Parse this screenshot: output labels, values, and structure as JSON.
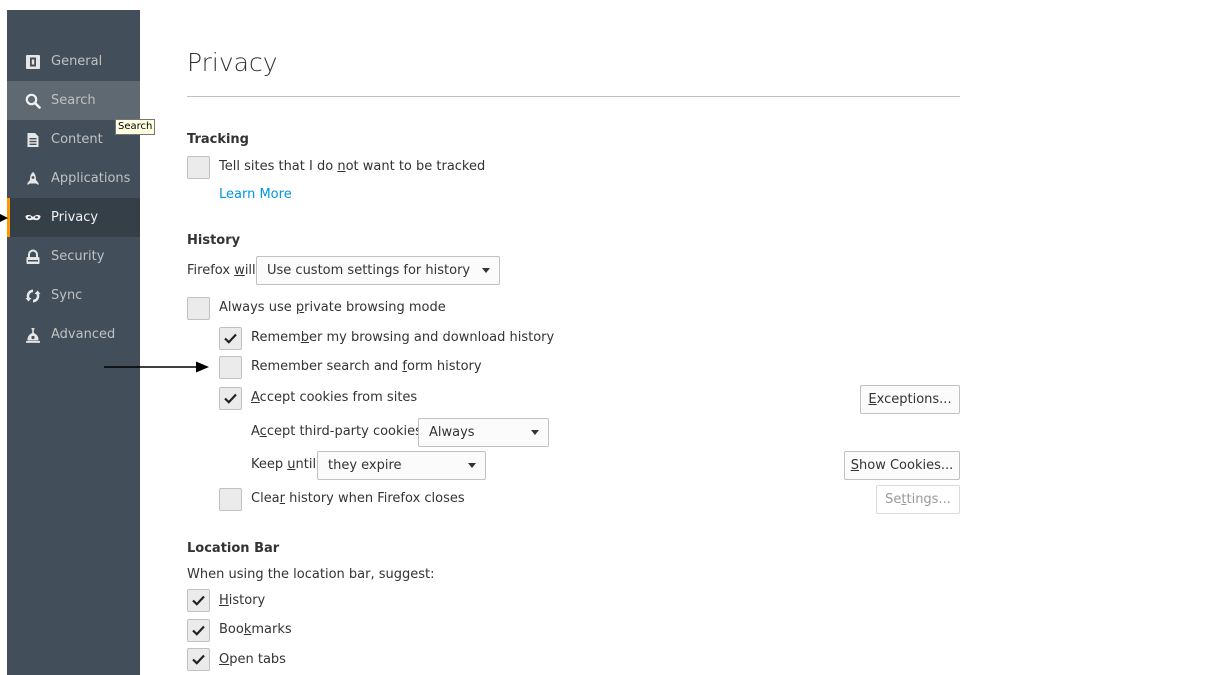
{
  "sidebar": {
    "items": [
      {
        "label": "General",
        "icon": "general-icon"
      },
      {
        "label": "Search",
        "icon": "search-icon"
      },
      {
        "label": "Content",
        "icon": "content-icon"
      },
      {
        "label": "Applications",
        "icon": "applications-icon"
      },
      {
        "label": "Privacy",
        "icon": "privacy-icon"
      },
      {
        "label": "Security",
        "icon": "security-icon"
      },
      {
        "label": "Sync",
        "icon": "sync-icon"
      },
      {
        "label": "Advanced",
        "icon": "advanced-icon"
      }
    ],
    "selected": "Privacy",
    "hovered": "Search",
    "tooltip": "Search"
  },
  "page": {
    "title": "Privacy"
  },
  "tracking": {
    "heading": "Tracking",
    "dnt_pre": "Tell sites that I do ",
    "dnt_u": "n",
    "dnt_post": "ot want to be tracked",
    "dnt_checked": false,
    "learn_more": "Learn More"
  },
  "history": {
    "heading": "History",
    "firefox_will_pre": "Firefox ",
    "firefox_will_u": "w",
    "firefox_will_post": "ill:",
    "mode_value": "Use custom settings for history",
    "private_pre": "Always use ",
    "private_u": "p",
    "private_post": "rivate browsing mode",
    "private_checked": false,
    "browsing_pre": "Remem",
    "browsing_u": "b",
    "browsing_post": "er my browsing and download history",
    "browsing_checked": true,
    "form_pre": "Remember search and ",
    "form_u": "f",
    "form_post": "orm history",
    "form_checked": false,
    "cookies_u": "A",
    "cookies_post": "ccept cookies from sites",
    "cookies_checked": true,
    "exceptions_u": "E",
    "exceptions_post": "xceptions...",
    "third_party_pre": "A",
    "third_party_u": "c",
    "third_party_post": "cept third-party cookies:",
    "third_party_value": "Always",
    "keep_pre": "Keep ",
    "keep_u": "u",
    "keep_post": "ntil:",
    "keep_value": "they expire",
    "show_cookies_u": "S",
    "show_cookies_post": "how Cookies...",
    "clear_pre": "Clea",
    "clear_u": "r",
    "clear_post": " history when Firefox closes",
    "clear_checked": false,
    "settings_pre": "Se",
    "settings_u": "t",
    "settings_post": "tings..."
  },
  "location_bar": {
    "heading": "Location Bar",
    "subtitle": "When using the location bar, suggest:",
    "history_u": "H",
    "history_post": "istory",
    "history_checked": true,
    "bookmarks_pre": "Boo",
    "bookmarks_u": "k",
    "bookmarks_post": "marks",
    "bookmarks_checked": true,
    "open_tabs_u": "O",
    "open_tabs_post": "pen tabs",
    "open_tabs_checked": true
  },
  "colors": {
    "sidebar_bg": "#424f5a",
    "accent": "#ff9500",
    "link": "#0096dd"
  }
}
